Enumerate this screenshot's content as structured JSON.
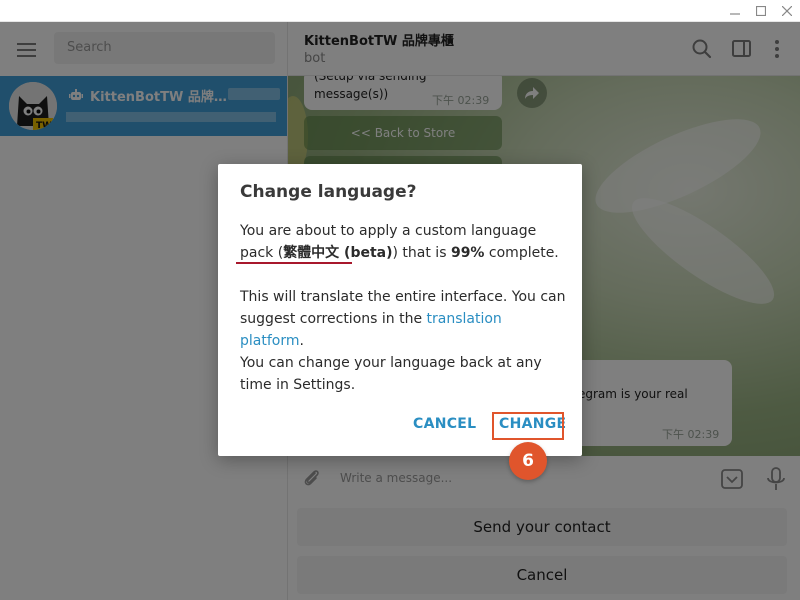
{
  "window": {
    "min_glyph": "—",
    "max_glyph": "□",
    "close_glyph": "✕"
  },
  "sidebar": {
    "search_placeholder": "Search",
    "chats": [
      {
        "title": "KittenBotTW 品牌…",
        "icon": "bot-icon"
      }
    ]
  },
  "header": {
    "title": "KittenBotTW 品牌專櫃",
    "subtitle": "bot"
  },
  "messages": {
    "top_bubble_lines": [
      "(Setup via sending",
      "message(s))"
    ],
    "top_bubble_time": "下午 02:39",
    "keyboard_buttons": [
      "<< Back to Store"
    ],
    "bottom_bubble_text": "egram is your real",
    "bottom_bubble_time": "下午 02:39"
  },
  "composer": {
    "placeholder": "Write a message..."
  },
  "reply_keyboard": {
    "send_contact": "Send your contact",
    "cancel": "Cancel"
  },
  "dialog": {
    "title": "Change language?",
    "p1_before": "You are about to apply a custom language pack (",
    "p1_pack": "繁體中文 (beta)",
    "p1_mid": ") that is ",
    "p1_percent": "99%",
    "p1_after": " complete.",
    "p2_before": "This will translate the entire interface. You can suggest corrections in the ",
    "p2_link": "translation platform",
    "p2_after": ".",
    "p3": "You can change your language back at any time in Settings.",
    "cancel_label": "CANCEL",
    "change_label": "CHANGE"
  },
  "annotation": {
    "step_number": "6"
  },
  "colors": {
    "accent": "#419fd9",
    "link": "#2a8ec2",
    "highlight": "#e0552c",
    "underline": "#a8182c"
  }
}
